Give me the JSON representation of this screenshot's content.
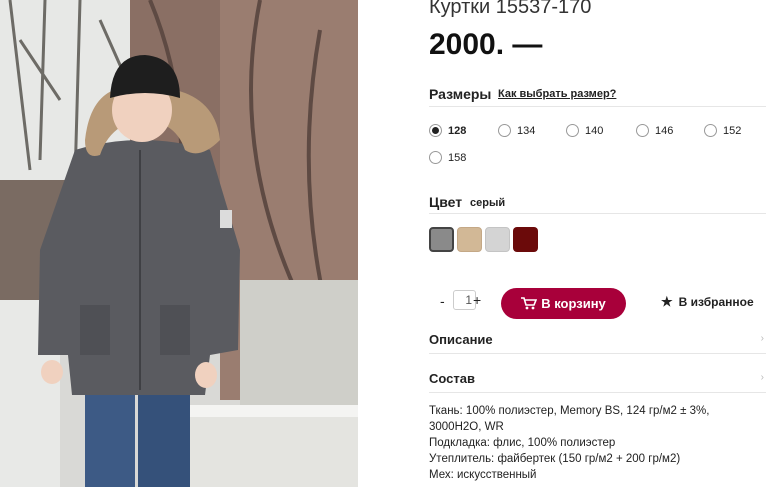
{
  "product": {
    "title": "Куртки 15537-170",
    "price": "2000. —"
  },
  "sizes": {
    "heading": "Размеры",
    "help_link": "Как выбрать размер?",
    "options": [
      "128",
      "134",
      "140",
      "146",
      "152",
      "158"
    ],
    "selected": "128"
  },
  "color": {
    "heading": "Цвет",
    "value": "серый",
    "swatches": [
      {
        "name": "серый",
        "hex": "#8a8a8a",
        "selected": true
      },
      {
        "name": "beige",
        "hex": "#d2b896",
        "selected": false
      },
      {
        "name": "light-grey",
        "hex": "#d4d4d4",
        "selected": false
      },
      {
        "name": "dark-red",
        "hex": "#6b0a0a",
        "selected": false
      }
    ]
  },
  "purchase": {
    "qty_minus": "-",
    "qty_value": "1",
    "qty_plus": "+",
    "cart_label": "В корзину",
    "favorite_label": "В избранное"
  },
  "sections": {
    "description": "Описание",
    "composition": "Состав"
  },
  "composition_lines": [
    "Ткань: 100% полиэстер, Memory BS, 124 гр/м2 ± 3%,",
    "3000H2O, WR",
    "Подкладка: флис, 100% полиэстер",
    "Утеплитель: файбертек (150 гр/м2 + 200 гр/м2)",
    "Мех: искусственный"
  ],
  "colors": {
    "accent": "#a8003a",
    "jacket": "#5a5b60",
    "jeans": "#3d5a85"
  }
}
